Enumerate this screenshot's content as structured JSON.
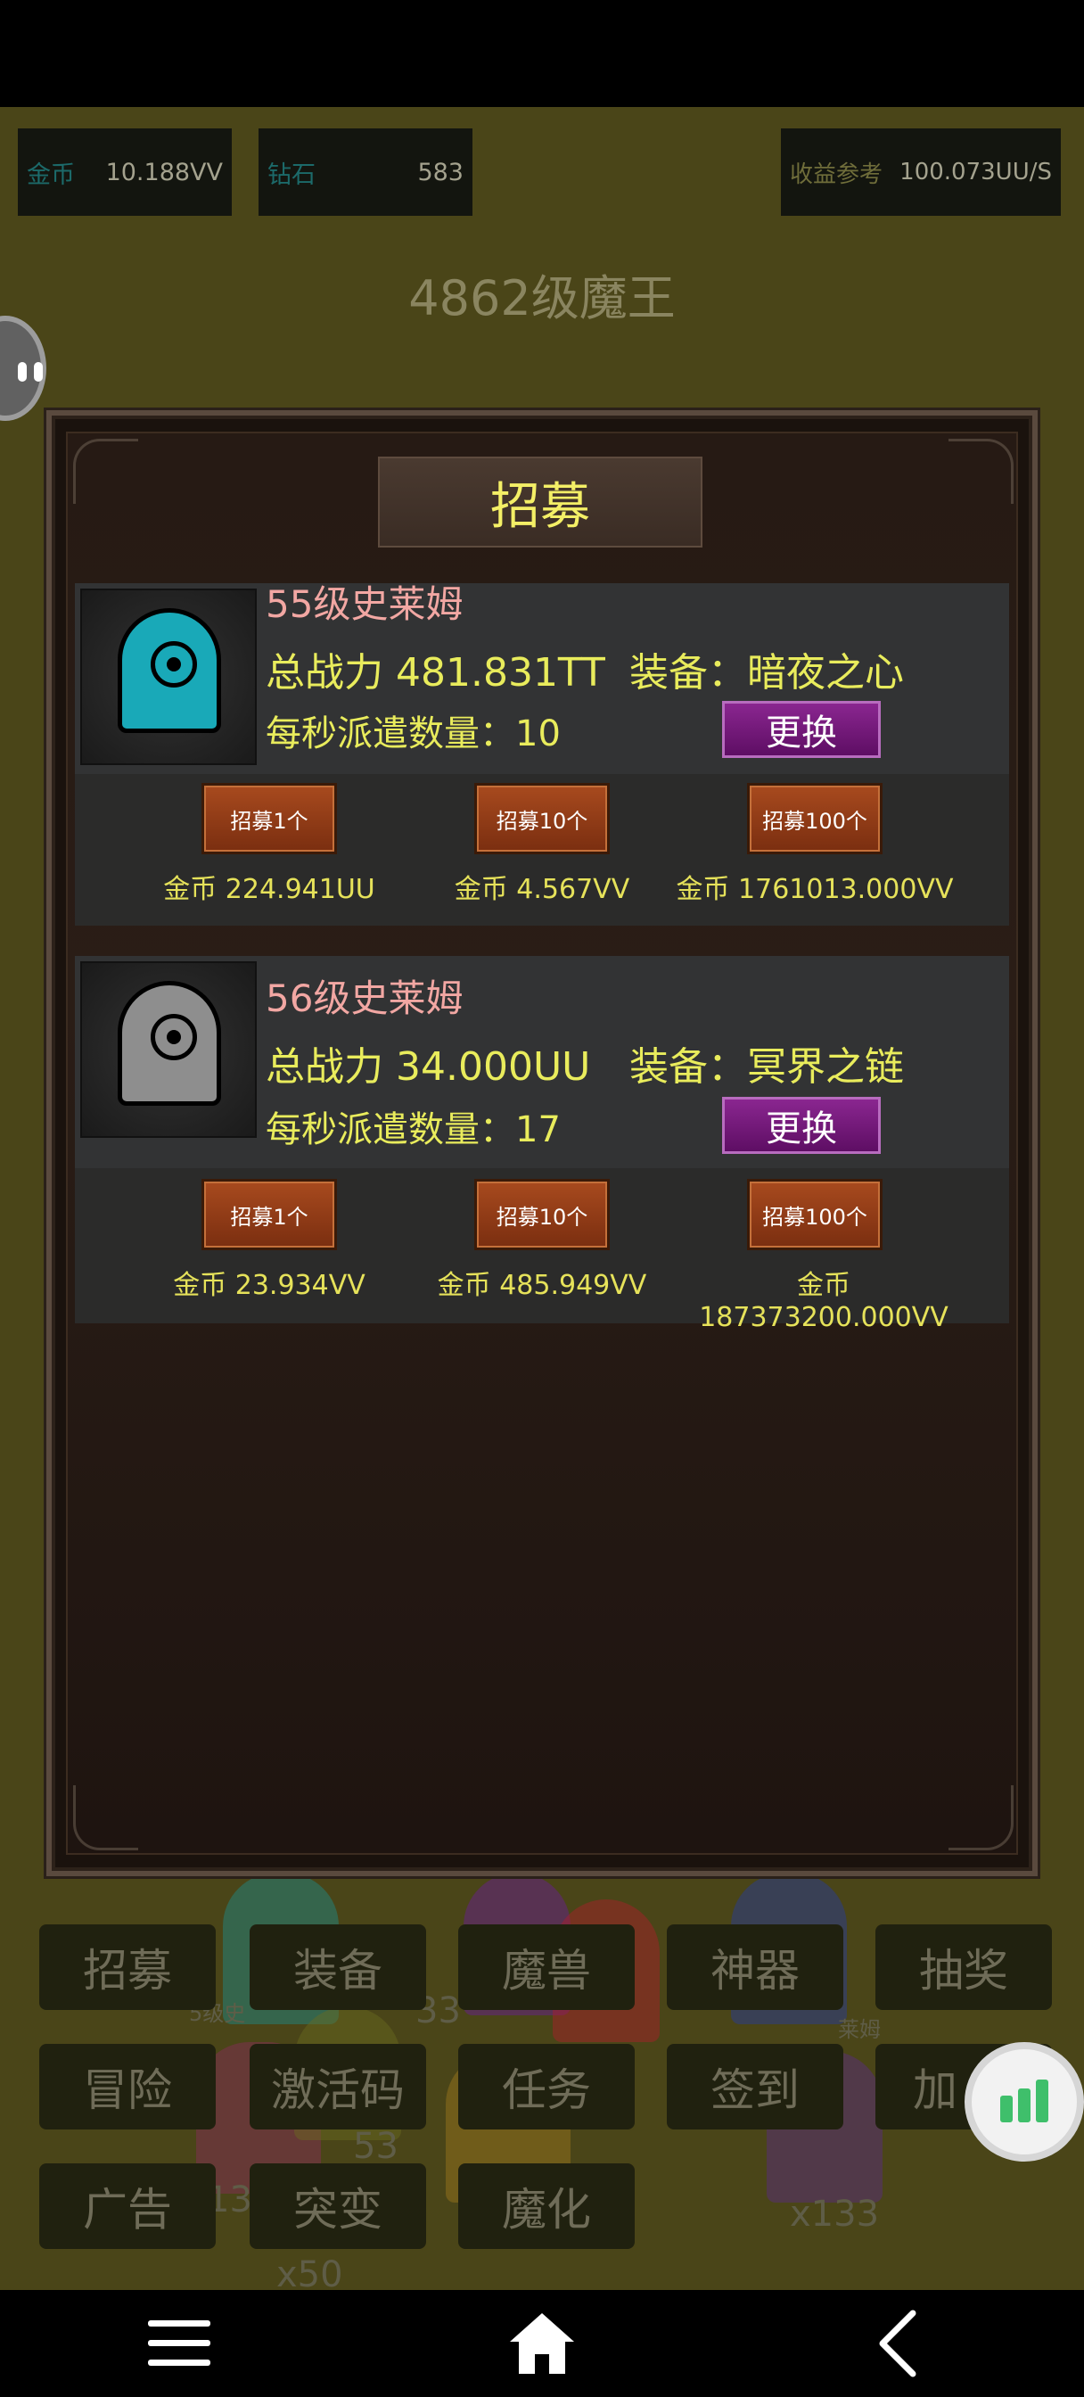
{
  "top_stats": {
    "gold_label": "金币",
    "gold_value": "10.188VV",
    "diamond_label": "钻石",
    "diamond_value": "583",
    "income_label": "收益参考",
    "income_value": "100.073UU/S"
  },
  "level_title": "4862级魔王",
  "modal": {
    "title": "招募",
    "cards": [
      {
        "name": "55级史莱姆",
        "power": "总战力 481.831TT",
        "equip": "装备：暗夜之心",
        "dispatch": "每秒派遣数量：10",
        "change_label": "更换",
        "slime_color": "#19a9b8",
        "recruit_buttons": [
          "招募1个",
          "招募10个",
          "招募100个"
        ],
        "costs": [
          "金币 224.941UU",
          "金币 4.567VV",
          "金币 1761013.000VV"
        ]
      },
      {
        "name": "56级史莱姆",
        "power": "总战力 34.000UU",
        "equip": "装备：冥界之链",
        "dispatch": "每秒派遣数量：17",
        "change_label": "更换",
        "slime_color": "#8e8e8e",
        "recruit_buttons": [
          "招募1个",
          "招募10个",
          "招募100个"
        ],
        "costs": [
          "金币 23.934VV",
          "金币 485.949VV",
          "金币 187373200.000VV"
        ]
      }
    ]
  },
  "bottom_menu": {
    "row1": [
      "招募",
      "装备",
      "魔兽",
      "神器",
      "抽奖"
    ],
    "row2": [
      "冒险",
      "激活码",
      "任务",
      "签到",
      "加"
    ],
    "row3": [
      "广告",
      "突变",
      "魔化"
    ]
  },
  "background_labels": {
    "count_a": "x133",
    "count_b": "x50",
    "slime_label_a": "5级史",
    "slime_label_b": "莱姆",
    "partial_a": "33",
    "partial_b": "13",
    "partial_c": "53"
  },
  "icons": {
    "fab": "bar-chart-icon",
    "nav_menu": "menu-icon",
    "nav_home": "home-icon",
    "nav_back": "back-icon"
  }
}
